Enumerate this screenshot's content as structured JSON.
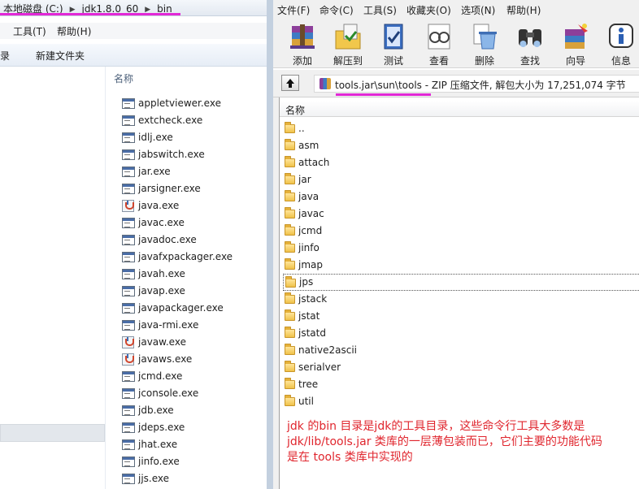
{
  "explorer": {
    "breadcrumb": [
      "本地磁盘 (C:)",
      "jdk1.8.0_60",
      "bin"
    ],
    "menu": [
      "工具(T)",
      "帮助(H)"
    ],
    "toolbar": {
      "partial_label": "组录",
      "new_folder": "新建文件夹"
    },
    "column_header": "名称",
    "files": [
      {
        "name": "appletviewer.exe",
        "icon": "exe-icon"
      },
      {
        "name": "extcheck.exe",
        "icon": "exe-icon"
      },
      {
        "name": "idlj.exe",
        "icon": "exe-icon"
      },
      {
        "name": "jabswitch.exe",
        "icon": "exe-icon"
      },
      {
        "name": "jar.exe",
        "icon": "exe-icon"
      },
      {
        "name": "jarsigner.exe",
        "icon": "exe-icon"
      },
      {
        "name": "java.exe",
        "icon": "java-icon"
      },
      {
        "name": "javac.exe",
        "icon": "exe-icon"
      },
      {
        "name": "javadoc.exe",
        "icon": "exe-icon"
      },
      {
        "name": "javafxpackager.exe",
        "icon": "exe-icon"
      },
      {
        "name": "javah.exe",
        "icon": "exe-icon"
      },
      {
        "name": "javap.exe",
        "icon": "exe-icon"
      },
      {
        "name": "javapackager.exe",
        "icon": "exe-icon"
      },
      {
        "name": "java-rmi.exe",
        "icon": "exe-icon"
      },
      {
        "name": "javaw.exe",
        "icon": "java-icon"
      },
      {
        "name": "javaws.exe",
        "icon": "java-icon"
      },
      {
        "name": "jcmd.exe",
        "icon": "exe-icon"
      },
      {
        "name": "jconsole.exe",
        "icon": "exe-icon"
      },
      {
        "name": "jdb.exe",
        "icon": "exe-icon"
      },
      {
        "name": "jdeps.exe",
        "icon": "exe-icon"
      },
      {
        "name": "jhat.exe",
        "icon": "exe-icon"
      },
      {
        "name": "jinfo.exe",
        "icon": "exe-icon"
      },
      {
        "name": "jjs.exe",
        "icon": "exe-icon"
      }
    ]
  },
  "winrar": {
    "menu": [
      "文件(F)",
      "命令(C)",
      "工具(S)",
      "收藏夹(O)",
      "选项(N)",
      "帮助(H)"
    ],
    "toolbar": [
      {
        "label": "添加",
        "icon": "add-archive-icon"
      },
      {
        "label": "解压到",
        "icon": "extract-to-icon"
      },
      {
        "label": "测试",
        "icon": "test-icon"
      },
      {
        "label": "查看",
        "icon": "view-icon"
      },
      {
        "label": "删除",
        "icon": "delete-icon"
      },
      {
        "label": "查找",
        "icon": "find-icon"
      },
      {
        "label": "向导",
        "icon": "wizard-icon"
      },
      {
        "label": "信息",
        "icon": "info-icon"
      }
    ],
    "path_text": "tools.jar\\sun\\tools - ZIP 压缩文件, 解包大小为 17,251,074 字节",
    "column_header": "名称",
    "folders": [
      "..",
      "asm",
      "attach",
      "jar",
      "java",
      "javac",
      "jcmd",
      "jinfo",
      "jmap",
      "jps",
      "jstack",
      "jstat",
      "jstatd",
      "native2ascii",
      "serialver",
      "tree",
      "util"
    ],
    "selected_folder": "jps"
  },
  "annotation": {
    "lines": [
      "jdk 的bin 目录是jdk的工具目录，这些命令行工具大多数是",
      "jdk/lib/tools.jar 类库的一层薄包装而已，它们主要的功能代码",
      "是在 tools 类库中实现的"
    ],
    "color": "#e0262e"
  },
  "colors": {
    "highlight_underline": "#e228d6"
  }
}
